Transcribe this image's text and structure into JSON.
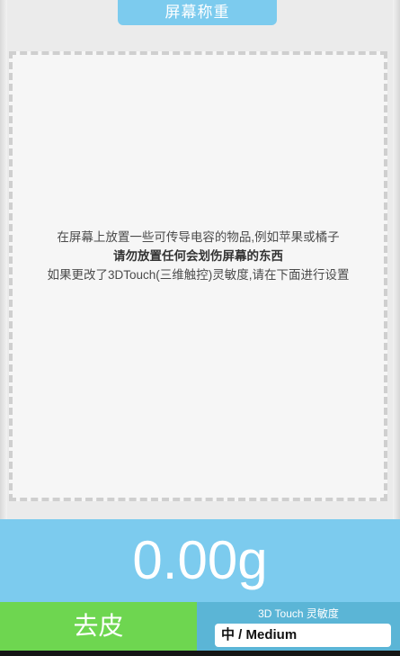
{
  "header": {
    "title": "屏幕称重"
  },
  "instructions": {
    "line1": "在屏幕上放置一些可传导电容的物品,例如苹果或橘子",
    "line2": "请勿放置任何会划伤屏幕的东西",
    "line3": "如果更改了3DTouch(三维触控)灵敏度,请在下面进行设置"
  },
  "readout": {
    "weight": "0.00g"
  },
  "controls": {
    "tare_label": "去皮",
    "sensitivity_label": "3D Touch 灵敏度",
    "sensitivity_value": "中 / Medium"
  },
  "colors": {
    "accent_blue": "#7ccbee",
    "tare_green": "#6ed650",
    "panel_blue": "#5bb5d6"
  }
}
